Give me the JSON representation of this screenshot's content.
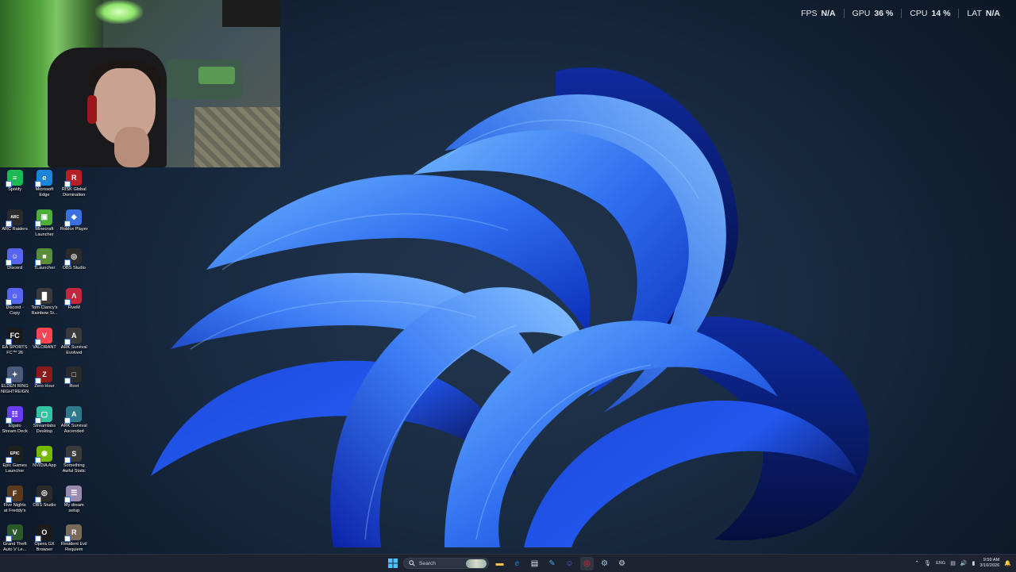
{
  "overlay": {
    "stats": [
      {
        "label": "FPS",
        "value": "N/A"
      },
      {
        "label": "GPU",
        "value": "36 %"
      },
      {
        "label": "CPU",
        "value": "14 %"
      },
      {
        "label": "LAT",
        "value": "N/A"
      }
    ]
  },
  "desktop_icons": [
    {
      "label": "Spotify",
      "icon": "spotify-icon",
      "color": "#1db954",
      "glyph": "≡"
    },
    {
      "label": "Microsoft\nEdge",
      "icon": "edge-icon",
      "color": "#1b86d8",
      "glyph": "e"
    },
    {
      "label": "RISK Global\nDomination",
      "icon": "risk-icon",
      "color": "#b71f24",
      "glyph": "R"
    },
    {
      "label": "ARC Raiders",
      "icon": "arc-raiders-icon",
      "color": "#2a2a2a",
      "glyph": "ARC"
    },
    {
      "label": "Minecraft\nLauncher",
      "icon": "minecraft-icon",
      "color": "#4caf3a",
      "glyph": "▣"
    },
    {
      "label": "Roblox Player",
      "icon": "roblox-icon",
      "color": "#3a6fe0",
      "glyph": "◆"
    },
    {
      "label": "Discord",
      "icon": "discord-icon",
      "color": "#5865f2",
      "glyph": "☺"
    },
    {
      "label": "TLauncher",
      "icon": "tlauncher-icon",
      "color": "#5a8f3a",
      "glyph": "■"
    },
    {
      "label": "OBS Studio",
      "icon": "obs-icon",
      "color": "#2b2b2b",
      "glyph": "◎"
    },
    {
      "label": "Discord -\nCopy",
      "icon": "discord-icon",
      "color": "#5865f2",
      "glyph": "☺"
    },
    {
      "label": "Tom Clancy's\nRainbow Si...",
      "icon": "rainbow-six-icon",
      "color": "#3b3b3b",
      "glyph": "█"
    },
    {
      "label": "FiveM",
      "icon": "fivem-icon",
      "color": "#c2273d",
      "glyph": "Λ"
    },
    {
      "label": "EA SPORTS\nFC™ 26",
      "icon": "ea-fc-icon",
      "color": "#1a1a1a",
      "glyph": "FC"
    },
    {
      "label": "VALORANT",
      "icon": "valorant-icon",
      "color": "#fa4454",
      "glyph": "V"
    },
    {
      "label": "ARK Survival\nEvolved",
      "icon": "ark-evolved-icon",
      "color": "#3a3a3a",
      "glyph": "A"
    },
    {
      "label": "ELDEN RING\nNIGHTREIGN",
      "icon": "elden-ring-icon",
      "color": "#4a5a7a",
      "glyph": "✦"
    },
    {
      "label": "Zero Hour",
      "icon": "zero-hour-icon",
      "color": "#8b1a1a",
      "glyph": "Z"
    },
    {
      "label": "Root",
      "icon": "root-icon",
      "color": "#2b2b2b",
      "glyph": "□"
    },
    {
      "label": "Elgato\nStream Deck",
      "icon": "stream-deck-icon",
      "color": "#6a3cf0",
      "glyph": "☷"
    },
    {
      "label": "Streamlabs\nDesktop",
      "icon": "streamlabs-icon",
      "color": "#31c3a2",
      "glyph": "▢"
    },
    {
      "label": "ARK Survival\nAscended",
      "icon": "ark-ascended-icon",
      "color": "#2f7a8a",
      "glyph": "A"
    },
    {
      "label": "Epic Games\nLauncher",
      "icon": "epic-games-icon",
      "color": "#1f1f1f",
      "glyph": "EPIC"
    },
    {
      "label": "NVIDIA App",
      "icon": "nvidia-icon",
      "color": "#76b900",
      "glyph": "◉"
    },
    {
      "label": "Something\nAwful Static",
      "icon": "something-awful-icon",
      "color": "#3a3a3a",
      "glyph": "S"
    },
    {
      "label": "Five Nights\nat Freddy's",
      "icon": "fnaf-icon",
      "color": "#5a3a1a",
      "glyph": "F"
    },
    {
      "label": "OBS Studio",
      "icon": "obs-icon",
      "color": "#2b2b2b",
      "glyph": "◎"
    },
    {
      "label": "My dream\nsetup",
      "icon": "my-dream-setup-icon",
      "color": "#9a8ab0",
      "glyph": "☰"
    },
    {
      "label": "Grand Theft\nAuto V Le...",
      "icon": "gta-v-icon",
      "color": "#2a5a2a",
      "glyph": "V"
    },
    {
      "label": "Opera GX\nBrowser",
      "icon": "opera-gx-icon",
      "color": "#1a1a1a",
      "glyph": "O"
    },
    {
      "label": "Resident Evil\nRequiem",
      "icon": "resident-evil-icon",
      "color": "#7a6a5a",
      "glyph": "R"
    }
  ],
  "taskbar": {
    "search_label": "Search",
    "apps": [
      {
        "icon": "file-explorer-icon",
        "color": "#f2c14e",
        "glyph": "▬"
      },
      {
        "icon": "edge-icon",
        "color": "#1b86d8",
        "glyph": "e"
      },
      {
        "icon": "microsoft-store-icon",
        "color": "#e9e9e9",
        "glyph": "▤"
      },
      {
        "icon": "pen-app-icon",
        "color": "#4aa3f0",
        "glyph": "✎"
      },
      {
        "icon": "discord-icon",
        "color": "#5865f2",
        "glyph": "☺"
      },
      {
        "icon": "obs-icon",
        "color": "#c33",
        "glyph": "◎"
      },
      {
        "icon": "steam-icon",
        "color": "#9fc7e6",
        "glyph": "⚙"
      },
      {
        "icon": "settings-icon",
        "color": "#d0d0d0",
        "glyph": "⚙"
      }
    ],
    "tray": {
      "language": "ENG",
      "time": "9:59 AM",
      "date": "3/10/2026"
    }
  }
}
